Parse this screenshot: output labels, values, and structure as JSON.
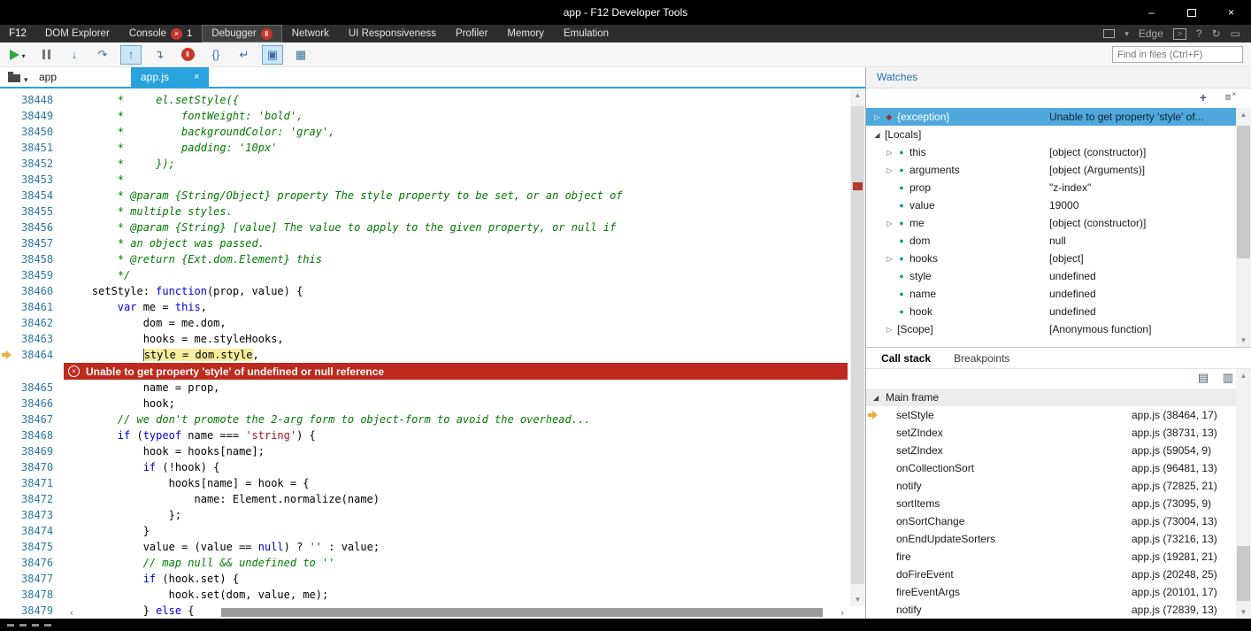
{
  "titlebar": {
    "title": "app - F12 Developer Tools",
    "minimize": "–",
    "close": "×"
  },
  "tabbar": {
    "f12": "F12",
    "edge_label": "Edge",
    "help_label": "?",
    "tabs": [
      {
        "label": "DOM Explorer"
      },
      {
        "label": "Console",
        "badge": "error",
        "badge_count": "1"
      },
      {
        "label": "Debugger",
        "badge": "pause",
        "active": true
      },
      {
        "label": "Network"
      },
      {
        "label": "UI Responsiveness"
      },
      {
        "label": "Profiler"
      },
      {
        "label": "Memory"
      },
      {
        "label": "Emulation"
      }
    ]
  },
  "toolbar": {
    "find_placeholder": "Find in files (Ctrl+F)",
    "buttons": [
      {
        "name": "continue-button",
        "type": "play",
        "caret": true
      },
      {
        "name": "break-button",
        "type": "pause"
      },
      {
        "name": "step-into-button",
        "type": "text",
        "icon": "↓"
      },
      {
        "name": "step-over-button",
        "type": "text",
        "icon": "↷"
      },
      {
        "name": "step-out-button",
        "type": "text",
        "icon": "↑",
        "toggled": true
      },
      {
        "name": "break-on-new-worker-button",
        "type": "text",
        "icon": "↴"
      },
      {
        "name": "exception-control-button",
        "type": "exception"
      },
      {
        "name": "format-code-button",
        "type": "text",
        "icon": "{}"
      },
      {
        "name": "word-wrap-button",
        "type": "text",
        "icon": "↵"
      },
      {
        "name": "just-my-code-button",
        "type": "text",
        "icon": "▣",
        "toggled": true
      },
      {
        "name": "source-maps-button",
        "type": "text",
        "icon": "▦"
      }
    ]
  },
  "filebar": {
    "folder_label": "app",
    "tab": {
      "label": "app.js",
      "close": "×"
    }
  },
  "editor": {
    "error_after_line": 38464,
    "error_text": "Unable to get property 'style' of undefined or null reference",
    "lines": [
      {
        "n": 38448,
        "t": [
          [
            "cm",
            "        *     el.setStyle({"
          ]
        ]
      },
      {
        "n": 38449,
        "t": [
          [
            "cm",
            "        *         fontWeight: 'bold',"
          ]
        ]
      },
      {
        "n": 38450,
        "t": [
          [
            "cm",
            "        *         backgroundColor: 'gray',"
          ]
        ]
      },
      {
        "n": 38451,
        "t": [
          [
            "cm",
            "        *         padding: '10px'"
          ]
        ]
      },
      {
        "n": 38452,
        "t": [
          [
            "cm",
            "        *     });"
          ]
        ]
      },
      {
        "n": 38453,
        "t": [
          [
            "cm",
            "        *"
          ]
        ]
      },
      {
        "n": 38454,
        "t": [
          [
            "cm",
            "        * @param {String/Object} property The style property to be set, or an object of"
          ]
        ]
      },
      {
        "n": 38455,
        "t": [
          [
            "cm",
            "        * multiple styles."
          ]
        ]
      },
      {
        "n": 38456,
        "t": [
          [
            "cm",
            "        * @param {String} [value] The value to apply to the given property, or null if"
          ]
        ]
      },
      {
        "n": 38457,
        "t": [
          [
            "cm",
            "        * an object was passed."
          ]
        ]
      },
      {
        "n": 38458,
        "t": [
          [
            "cm",
            "        * @return {Ext.dom.Element} this"
          ]
        ]
      },
      {
        "n": 38459,
        "t": [
          [
            "cm",
            "        */"
          ]
        ]
      },
      {
        "n": 38460,
        "t": [
          [
            "pl",
            "    setStyle: "
          ],
          [
            "kw",
            "function"
          ],
          [
            "pl",
            "(prop, value) {"
          ]
        ]
      },
      {
        "n": 38461,
        "t": [
          [
            "pl",
            "        "
          ],
          [
            "kw",
            "var"
          ],
          [
            "pl",
            " me = "
          ],
          [
            "kw",
            "this"
          ],
          [
            "pl",
            ","
          ]
        ]
      },
      {
        "n": 38462,
        "t": [
          [
            "pl",
            "            dom = me.dom,"
          ]
        ]
      },
      {
        "n": 38463,
        "t": [
          [
            "pl",
            "            hooks = me.styleHooks,"
          ]
        ]
      },
      {
        "n": 38464,
        "cur": true,
        "t": [
          [
            "pl",
            "            "
          ],
          [
            "hl",
            "style = dom.style"
          ],
          [
            "pl",
            ","
          ]
        ]
      },
      {
        "n": 38465,
        "t": [
          [
            "pl",
            "            name = prop,"
          ]
        ]
      },
      {
        "n": 38466,
        "t": [
          [
            "pl",
            "            hook;"
          ]
        ]
      },
      {
        "n": 38467,
        "t": [
          [
            "pl",
            "        "
          ],
          [
            "cm",
            "// we don't promote the 2-arg form to object-form to avoid the overhead..."
          ]
        ]
      },
      {
        "n": 38468,
        "t": [
          [
            "pl",
            "        "
          ],
          [
            "kw",
            "if"
          ],
          [
            "pl",
            " ("
          ],
          [
            "kw",
            "typeof"
          ],
          [
            "pl",
            " name === "
          ],
          [
            "str",
            "'string'"
          ],
          [
            "pl",
            ") {"
          ]
        ]
      },
      {
        "n": 38469,
        "t": [
          [
            "pl",
            "            hook = hooks[name];"
          ]
        ]
      },
      {
        "n": 38470,
        "t": [
          [
            "pl",
            "            "
          ],
          [
            "kw",
            "if"
          ],
          [
            "pl",
            " (!hook) {"
          ]
        ]
      },
      {
        "n": 38471,
        "t": [
          [
            "pl",
            "                hooks[name] = hook = {"
          ]
        ]
      },
      {
        "n": 38472,
        "t": [
          [
            "pl",
            "                    name: Element.normalize(name)"
          ]
        ]
      },
      {
        "n": 38473,
        "t": [
          [
            "pl",
            "                };"
          ]
        ]
      },
      {
        "n": 38474,
        "t": [
          [
            "pl",
            "            }"
          ]
        ]
      },
      {
        "n": 38475,
        "t": [
          [
            "pl",
            "            value = (value == "
          ],
          [
            "kw",
            "null"
          ],
          [
            "pl",
            ") ? "
          ],
          [
            "str",
            "''"
          ],
          [
            "pl",
            " : value;"
          ]
        ]
      },
      {
        "n": 38476,
        "t": [
          [
            "pl",
            "            "
          ],
          [
            "cm",
            "// map null && undefined to ''"
          ]
        ]
      },
      {
        "n": 38477,
        "t": [
          [
            "pl",
            "            "
          ],
          [
            "kw",
            "if"
          ],
          [
            "pl",
            " (hook.set) {"
          ]
        ]
      },
      {
        "n": 38478,
        "t": [
          [
            "pl",
            "                hook.set(dom, value, me);"
          ]
        ]
      },
      {
        "n": 38479,
        "t": [
          [
            "pl",
            "            } "
          ],
          [
            "kw",
            "else"
          ],
          [
            "pl",
            " {"
          ]
        ]
      }
    ]
  },
  "watches": {
    "title": "Watches",
    "rows": [
      {
        "name": "{exception}",
        "value": "Unable to get property 'style' of...",
        "state": "collapsed",
        "icon": "exception",
        "depth": 0,
        "selected": true
      },
      {
        "name": "[Locals]",
        "value": "",
        "state": "expanded",
        "icon": "none",
        "depth": 0
      },
      {
        "name": "this",
        "value": "[object (constructor)]",
        "state": "collapsed",
        "icon": "object",
        "depth": 1
      },
      {
        "name": "arguments",
        "value": "[object (Arguments)]",
        "state": "collapsed",
        "icon": "object",
        "depth": 1
      },
      {
        "name": "prop",
        "value": "\"z-index\"",
        "state": "leaf",
        "icon": "object",
        "depth": 1
      },
      {
        "name": "value",
        "value": "19000",
        "state": "leaf",
        "icon": "object",
        "depth": 1
      },
      {
        "name": "me",
        "value": "[object (constructor)]",
        "state": "collapsed",
        "icon": "object",
        "depth": 1
      },
      {
        "name": "dom",
        "value": "null",
        "state": "leaf",
        "icon": "object",
        "depth": 1
      },
      {
        "name": "hooks",
        "value": "[object]",
        "state": "collapsed",
        "icon": "object",
        "depth": 1
      },
      {
        "name": "style",
        "value": "undefined",
        "state": "leaf",
        "icon": "object",
        "depth": 1
      },
      {
        "name": "name",
        "value": "undefined",
        "state": "leaf",
        "icon": "object",
        "depth": 1
      },
      {
        "name": "hook",
        "value": "undefined",
        "state": "leaf",
        "icon": "object",
        "depth": 1
      },
      {
        "name": "[Scope]",
        "value": "[Anonymous function]",
        "state": "collapsed",
        "icon": "none",
        "depth": 1
      }
    ]
  },
  "callstack": {
    "tabs": [
      {
        "label": "Call stack",
        "active": true
      },
      {
        "label": "Breakpoints"
      }
    ],
    "group_label": "Main frame",
    "frames": [
      {
        "name": "setStyle",
        "location": "app.js (38464, 17)",
        "current": true
      },
      {
        "name": "setZIndex",
        "location": "app.js (38731, 13)"
      },
      {
        "name": "setZIndex",
        "location": "app.js (59054, 9)"
      },
      {
        "name": "onCollectionSort",
        "location": "app.js (96481, 13)"
      },
      {
        "name": "notify",
        "location": "app.js (72825, 21)"
      },
      {
        "name": "sortItems",
        "location": "app.js (73095, 9)"
      },
      {
        "name": "onSortChange",
        "location": "app.js (73004, 13)"
      },
      {
        "name": "onEndUpdateSorters",
        "location": "app.js (73216, 13)"
      },
      {
        "name": "fire",
        "location": "app.js (19281, 21)"
      },
      {
        "name": "doFireEvent",
        "location": "app.js (20248, 25)"
      },
      {
        "name": "fireEventArgs",
        "location": "app.js (20101, 17)"
      },
      {
        "name": "notify",
        "location": "app.js (72839, 13)"
      }
    ]
  }
}
